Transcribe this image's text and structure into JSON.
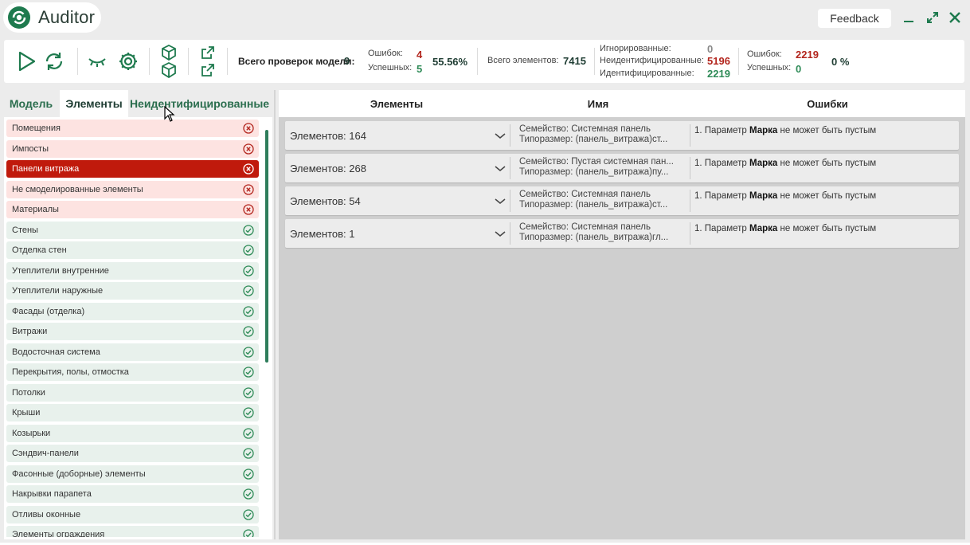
{
  "app": {
    "title": "Auditor",
    "feedback_label": "Feedback"
  },
  "colors": {
    "brand": "#1e7a4e",
    "error": "#b3261e",
    "success": "#2e8b57",
    "selected": "#c01a0c"
  },
  "toolbar": {
    "icons": [
      "play-icon",
      "refresh-icon",
      "eye-closed-icon",
      "gear-icon",
      "cube-icon",
      "cubes-icon",
      "export-icon",
      "export-alt-icon"
    ],
    "model_checks_label": "Всего проверок модели:",
    "model_checks_value": "9",
    "model_errors_label": "Ошибок:",
    "model_errors_value": "4",
    "model_success_label": "Успешных:",
    "model_success_value": "5",
    "model_percent": "55.56%",
    "total_elements_label": "Всего элементов:",
    "total_elements_value": "7415",
    "ignored_label": "Игнорированные:",
    "ignored_value": "0",
    "unidentified_label": "Неидентифицированные:",
    "unidentified_value": "5196",
    "identified_label": "Идентифицированные:",
    "identified_value": "2219",
    "el_errors_label": "Ошибок:",
    "el_errors_value": "2219",
    "el_success_label": "Успешных:",
    "el_success_value": "0",
    "el_percent": "0 %"
  },
  "tabs": [
    {
      "label": "Модель"
    },
    {
      "label": "Элементы"
    },
    {
      "label": "Неидентифицированные"
    }
  ],
  "categories": [
    {
      "label": "Помещения",
      "status": "error"
    },
    {
      "label": "Импосты",
      "status": "error"
    },
    {
      "label": "Панели витража",
      "status": "selected"
    },
    {
      "label": "Не смоделированные элементы",
      "status": "error"
    },
    {
      "label": "Материалы",
      "status": "error"
    },
    {
      "label": "Стены",
      "status": "ok"
    },
    {
      "label": "Отделка стен",
      "status": "ok"
    },
    {
      "label": "Утеплители внутренние",
      "status": "ok"
    },
    {
      "label": "Утеплители наружные",
      "status": "ok"
    },
    {
      "label": "Фасады (отделка)",
      "status": "ok"
    },
    {
      "label": "Витражи",
      "status": "ok"
    },
    {
      "label": "Водосточная система",
      "status": "ok"
    },
    {
      "label": "Перекрытия, полы, отмостка",
      "status": "ok"
    },
    {
      "label": "Потолки",
      "status": "ok"
    },
    {
      "label": "Крыши",
      "status": "ok"
    },
    {
      "label": "Козырьки",
      "status": "ok"
    },
    {
      "label": "Сэндвич-панели",
      "status": "ok"
    },
    {
      "label": "Фасонные (доборные) элементы",
      "status": "ok"
    },
    {
      "label": "Накрывки парапета",
      "status": "ok"
    },
    {
      "label": "Отливы оконные",
      "status": "ok"
    },
    {
      "label": "Элементы ограждения",
      "status": "ok"
    }
  ],
  "table": {
    "columns": [
      "Элементы",
      "Имя",
      "Ошибки"
    ],
    "rows": [
      {
        "count": "Элементов: 164",
        "family": "Семейство: Системная панель",
        "type": "Типоразмер: (панель_витража)ст...",
        "error_prefix": "1. Параметр",
        "error_param": "Марка",
        "error_suffix": "не может быть пустым"
      },
      {
        "count": "Элементов: 268",
        "family": "Семейство: Пустая системная пан...",
        "type": "Типоразмер: (панель_витража)пу...",
        "error_prefix": "1. Параметр",
        "error_param": "Марка",
        "error_suffix": "не может быть пустым"
      },
      {
        "count": "Элементов: 54",
        "family": "Семейство: Системная панель",
        "type": "Типоразмер: (панель_витража)ст...",
        "error_prefix": "1. Параметр",
        "error_param": "Марка",
        "error_suffix": "не может быть пустым"
      },
      {
        "count": "Элементов: 1",
        "family": "Семейство: Системная панель",
        "type": "Типоразмер: (панель_витража)гл...",
        "error_prefix": "1. Параметр",
        "error_param": "Марка",
        "error_suffix": "не может быть пустым"
      }
    ]
  }
}
